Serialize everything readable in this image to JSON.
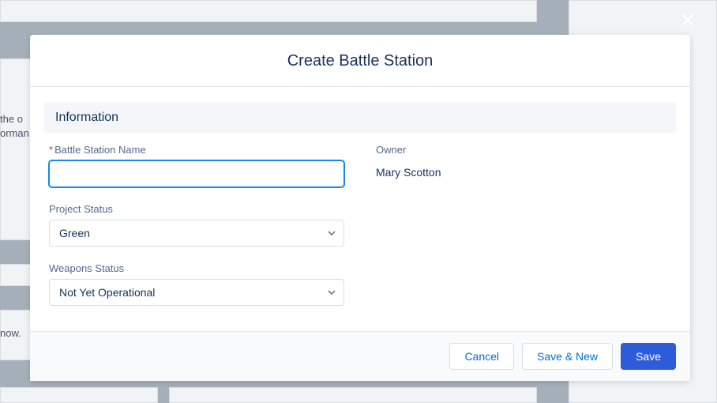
{
  "modal": {
    "title": "Create Battle Station",
    "section_title": "Information",
    "fields": {
      "name": {
        "label": "Battle Station Name",
        "value": ""
      },
      "owner": {
        "label": "Owner",
        "value": "Mary Scotton"
      },
      "project_status": {
        "label": "Project Status",
        "value": "Green"
      },
      "weapons_status": {
        "label": "Weapons Status",
        "value": "Not Yet Operational"
      }
    },
    "buttons": {
      "cancel": "Cancel",
      "save_new": "Save & New",
      "save": "Save"
    }
  },
  "background": {
    "frag1": "the o",
    "frag2": "orman",
    "frag3": "now."
  }
}
